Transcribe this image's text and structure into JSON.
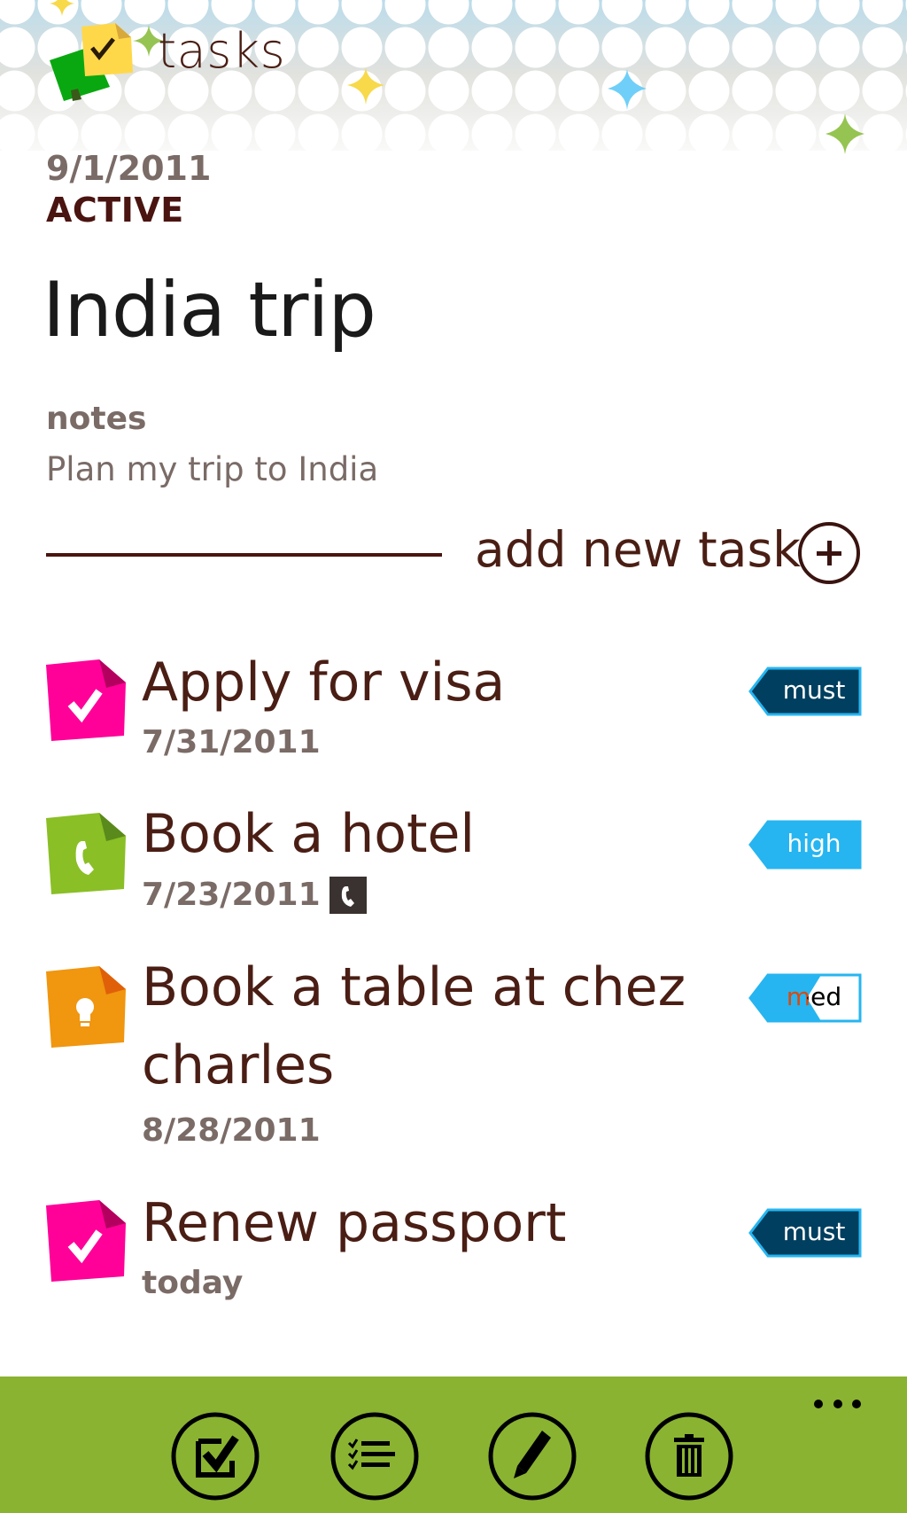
{
  "app": {
    "title": "tasks",
    "logo_icon": "sticky-notes-checkmark-icon"
  },
  "list": {
    "date": "9/1/2011",
    "status": "ACTIVE",
    "title": "India trip",
    "notes_label": "notes",
    "notes_text": "Plan my trip to India"
  },
  "add_task": {
    "label": "add new task",
    "icon": "plus-circle-icon"
  },
  "tasks": [
    {
      "title": "Apply for visa",
      "date": "7/31/2011",
      "icon": "check-icon",
      "icon_color": "#ff0099",
      "icon_fold_color": "#b3005f",
      "has_phone": false,
      "priority": "must",
      "priority_bg": "#003f5f",
      "priority_border": "#26b5f0",
      "priority_text": "#ffffff"
    },
    {
      "title": "Book a hotel",
      "date": "7/23/2011",
      "icon": "phone-icon",
      "icon_color": "#8abf26",
      "icon_fold_color": "#5a8a1c",
      "has_phone": true,
      "priority": "high",
      "priority_bg": "#26b5f0",
      "priority_border": "#26b5f0",
      "priority_text": "#ffffff"
    },
    {
      "title": "Book a table at chez charles",
      "title_line1": "Book a table at chez",
      "title_line2": "charles",
      "date": "8/28/2011",
      "icon": "lightbulb-icon",
      "icon_color": "#f0960f",
      "icon_fold_color": "#e0600a",
      "has_phone": false,
      "priority": "med",
      "priority_bg": "#26b5f0",
      "priority_border": "#26b5f0",
      "priority_text": "#26b5f0"
    },
    {
      "title": "Renew passport",
      "date": "today",
      "icon": "check-icon",
      "icon_color": "#ff0099",
      "icon_fold_color": "#b3005f",
      "has_phone": false,
      "priority": "must",
      "priority_bg": "#003f5f",
      "priority_border": "#26b5f0",
      "priority_text": "#ffffff"
    }
  ],
  "appbar": {
    "background": "#8ab331",
    "buttons": [
      {
        "name": "complete",
        "icon": "checkbox-icon"
      },
      {
        "name": "list",
        "icon": "checklist-icon"
      },
      {
        "name": "edit",
        "icon": "pencil-icon"
      },
      {
        "name": "delete",
        "icon": "trash-icon"
      }
    ],
    "more_icon": "ellipsis-icon"
  }
}
